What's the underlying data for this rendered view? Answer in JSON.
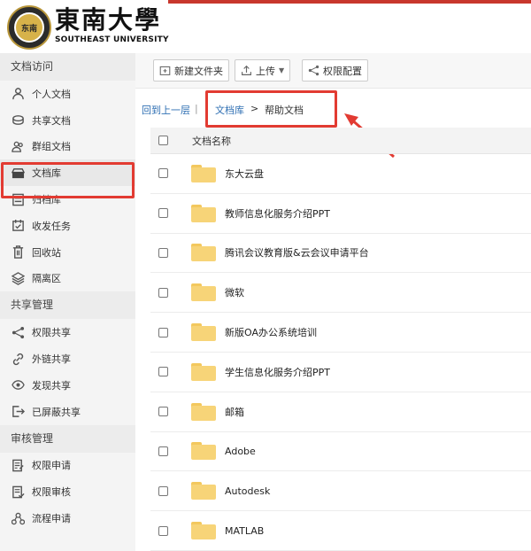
{
  "logo": {
    "seal_text": "东南",
    "cn_name": "東南大學",
    "en_name": "SOUTHEAST UNIVERSITY"
  },
  "sidebar": {
    "sections": [
      {
        "title": "文档访问",
        "items": [
          {
            "label": "个人文档",
            "icon": "person-icon"
          },
          {
            "label": "共享文档",
            "icon": "shared-docs-icon"
          },
          {
            "label": "群组文档",
            "icon": "group-icon"
          },
          {
            "label": "文档库",
            "icon": "library-icon",
            "active": true
          },
          {
            "label": "归档库",
            "icon": "archive-icon"
          },
          {
            "label": "收发任务",
            "icon": "task-icon"
          },
          {
            "label": "回收站",
            "icon": "trash-icon"
          },
          {
            "label": "隔离区",
            "icon": "quarantine-icon"
          }
        ]
      },
      {
        "title": "共享管理",
        "items": [
          {
            "label": "权限共享",
            "icon": "share-icon"
          },
          {
            "label": "外链共享",
            "icon": "link-icon"
          },
          {
            "label": "发现共享",
            "icon": "eye-icon"
          },
          {
            "label": "已屏蔽共享",
            "icon": "blocked-icon"
          }
        ]
      },
      {
        "title": "审核管理",
        "items": [
          {
            "label": "权限申请",
            "icon": "apply-icon"
          },
          {
            "label": "权限审核",
            "icon": "review-icon"
          },
          {
            "label": "流程申请",
            "icon": "flow-icon"
          }
        ]
      }
    ]
  },
  "toolbar": {
    "new_folder": "新建文件夹",
    "upload": "上传",
    "permission": "权限配置"
  },
  "breadcrumb": {
    "back": "回到上一层",
    "sep": "|",
    "library": "文档库",
    "gt": ">",
    "current": "帮助文档"
  },
  "table": {
    "header": "文档名称",
    "rows": [
      "东大云盘",
      "教师信息化服务介绍PPT",
      "腾讯会议教育版&云会议申请平台",
      "微软",
      "新版OA办公系统培训",
      "学生信息化服务介绍PPT",
      "邮箱",
      "Adobe",
      "Autodesk",
      "MATLAB"
    ]
  },
  "colors": {
    "accent_red": "#e23b32",
    "link_blue": "#2f6fb3",
    "folder_yellow": "#f7d478"
  }
}
